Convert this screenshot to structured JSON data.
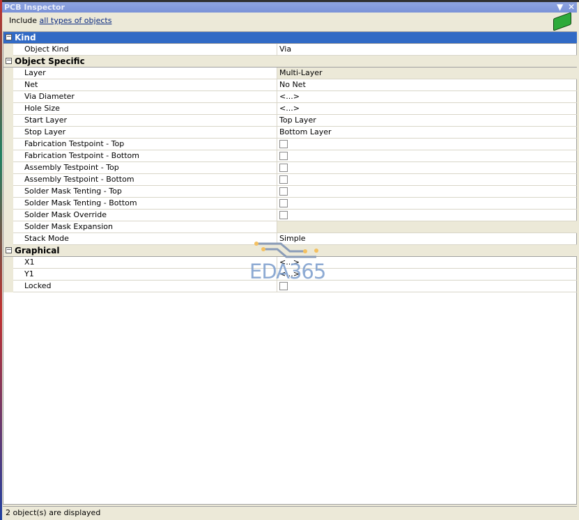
{
  "title": "PCB Inspector",
  "include": {
    "prefix": "Include",
    "link": "all types of objects"
  },
  "sections": [
    {
      "label": "Kind",
      "selected": true,
      "rows": [
        {
          "label": "Object Kind",
          "value": "Via"
        }
      ]
    },
    {
      "label": "Object Specific",
      "rows": [
        {
          "label": "Layer",
          "value": "Multi-Layer",
          "beige": true
        },
        {
          "label": "Net",
          "value": "No Net"
        },
        {
          "label": "Via Diameter",
          "value": "<...>"
        },
        {
          "label": "Hole Size",
          "value": "<...>"
        },
        {
          "label": "Start Layer",
          "value": "Top Layer"
        },
        {
          "label": "Stop Layer",
          "value": "Bottom Layer"
        },
        {
          "label": "Fabrication Testpoint - Top",
          "checkbox": false
        },
        {
          "label": "Fabrication Testpoint - Bottom",
          "checkbox": false
        },
        {
          "label": "Assembly Testpoint - Top",
          "checkbox": false
        },
        {
          "label": "Assembly Testpoint - Bottom",
          "checkbox": false
        },
        {
          "label": "Solder Mask Tenting - Top",
          "checkbox": false
        },
        {
          "label": "Solder Mask Tenting - Bottom",
          "checkbox": false
        },
        {
          "label": "Solder Mask Override",
          "checkbox": false
        },
        {
          "label": "Solder Mask Expansion",
          "value": "",
          "beige": true
        },
        {
          "label": "Stack Mode",
          "value": "Simple"
        }
      ]
    },
    {
      "label": "Graphical",
      "rows": [
        {
          "label": "X1",
          "value": "<...>"
        },
        {
          "label": "Y1",
          "value": "<...>"
        },
        {
          "label": "Locked",
          "checkbox": false
        }
      ]
    }
  ],
  "watermark": "EDA365",
  "status": "2 object(s) are displayed"
}
